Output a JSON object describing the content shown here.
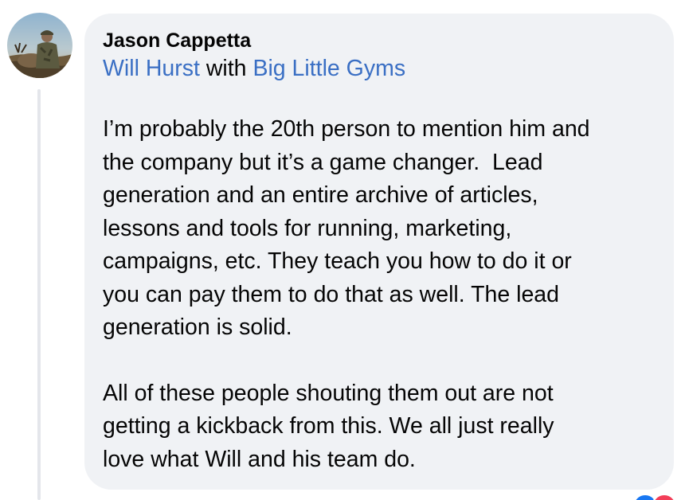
{
  "comment": {
    "author": "Jason Cappetta",
    "tags": {
      "tagged_person": "Will Hurst",
      "connector": " with ",
      "tagged_page": "Big Little Gyms"
    },
    "paragraph_1_lines": [
      "I’m probably the 20th person to mention him and",
      "the company but it’s a game changer.  Lead",
      "generation and an entire archive of articles,",
      "lessons and tools for running, marketing,",
      "campaigns, etc. They teach you how to do it or",
      "you can pay them to do that as well. The lead",
      "generation is solid."
    ],
    "paragraph_2_lines": [
      "All of these people shouting them out are not",
      "getting a kickback from this. We all just really",
      "love what Will and his team do."
    ]
  },
  "colors": {
    "bubble": "#f0f2f5",
    "link": "#3a6fc4",
    "text": "#050505"
  },
  "icons": {
    "avatar": "profile-photo",
    "reactions": [
      "like-reaction-icon",
      "love-reaction-icon"
    ]
  }
}
